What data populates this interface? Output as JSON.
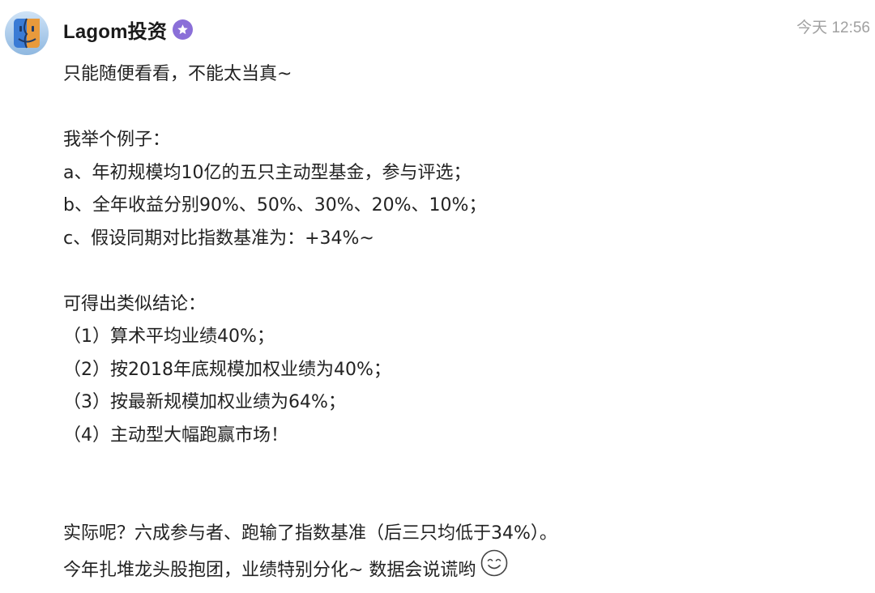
{
  "post": {
    "author_name": "Lagom投资",
    "timestamp": "今天 12:56",
    "icons": {
      "avatar": "finder-face-avatar",
      "verified": "star-badge-icon",
      "emoji": "smile-emoji-icon"
    },
    "colors": {
      "badge": "#8a6fd8",
      "timestamp": "#a0a0a0",
      "text": "#222222"
    },
    "paragraphs": {
      "intro": "只能随便看看，不能太当真~",
      "example_heading": "我举个例子：",
      "example_a": "a、年初规模均10亿的五只主动型基金，参与评选；",
      "example_b": "b、全年收益分别90%、50%、30%、20%、10%；",
      "example_c": "c、假设同期对比指数基准为：+34%~",
      "conclusion_heading": "可得出类似结论：",
      "conclusion_1": "（1）算术平均业绩40%；",
      "conclusion_2": "（2）按2018年底规模加权业绩为40%；",
      "conclusion_3": "（3）按最新规模加权业绩为64%；",
      "conclusion_4": "（4）主动型大幅跑赢市场！",
      "reality": "实际呢？六成参与者、跑输了指数基准（后三只均低于34%）。",
      "closing": "今年扎堆龙头股抱团，业绩特别分化~ 数据会说谎哟"
    }
  }
}
